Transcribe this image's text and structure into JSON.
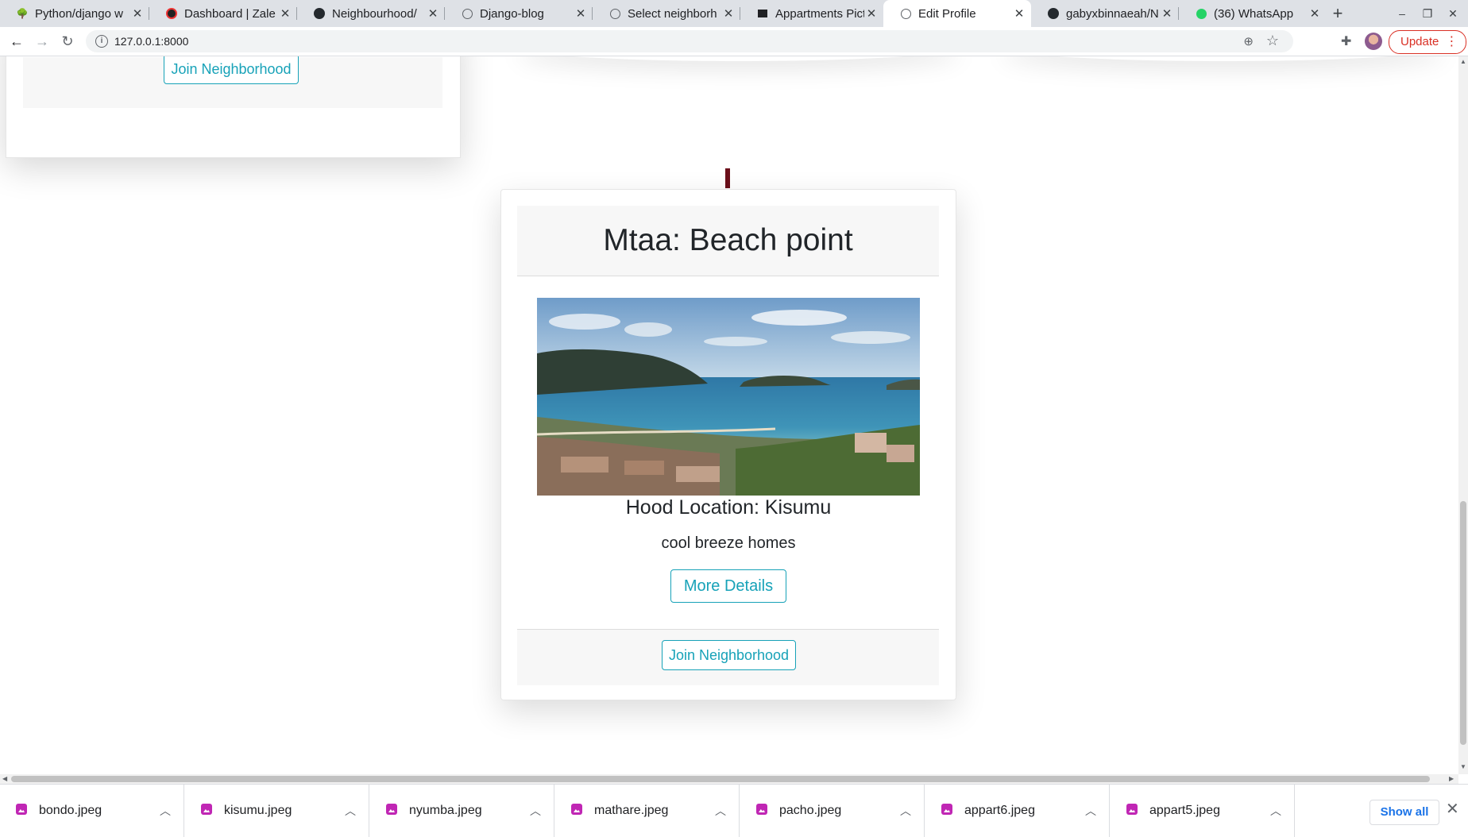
{
  "browser": {
    "tabs": [
      {
        "title": "Python/django w",
        "icon": "tree-icon",
        "active": false
      },
      {
        "title": "Dashboard | Zale",
        "icon": "zalego-icon",
        "active": false
      },
      {
        "title": "Neighbourhood/",
        "icon": "github-icon",
        "active": false
      },
      {
        "title": "Django-blog",
        "icon": "globe-icon",
        "active": false
      },
      {
        "title": "Select neighborh",
        "icon": "globe-icon",
        "active": false
      },
      {
        "title": "Appartments Pict",
        "icon": "unsplash-icon",
        "active": false
      },
      {
        "title": "Edit Profile",
        "icon": "globe-icon",
        "active": true
      },
      {
        "title": "gabyxbinnaeah/N",
        "icon": "github-icon",
        "active": false
      },
      {
        "title": "(36) WhatsApp",
        "icon": "whatsapp-icon",
        "active": false
      }
    ],
    "url": "127.0.0.1:8000",
    "update_label": "Update"
  },
  "page": {
    "prev_card_button": "Join Neighborhood",
    "card": {
      "title": "Mtaa: Beach point",
      "location": "Hood Location: Kisumu",
      "description": "cool breeze homes",
      "details_button": "More Details",
      "join_button": "Join Neighborhood"
    }
  },
  "downloads": {
    "items": [
      "bondo.jpeg",
      "kisumu.jpeg",
      "nyumba.jpeg",
      "mathare.jpeg",
      "pacho.jpeg",
      "appart6.jpeg",
      "appart5.jpeg"
    ],
    "show_all": "Show all"
  },
  "colors": {
    "accent": "#17a2b8",
    "brand_dark": "#6b0f1a",
    "update": "#d93025",
    "file_icon": "#c026b4"
  }
}
